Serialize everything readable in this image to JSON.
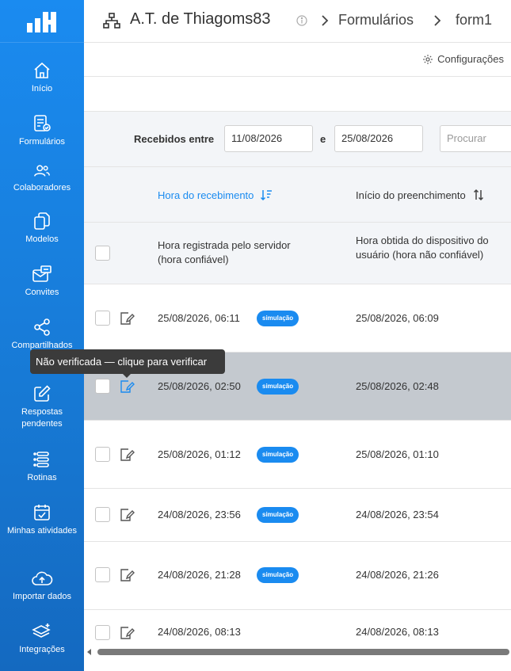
{
  "colors": {
    "accent": "#1a8bf0",
    "sidebar": "#1779d4",
    "highlight_row": "#c4c9cf",
    "tooltip_bg": "#3b3b3b"
  },
  "sidebar": {
    "logo_icon": "bar-chart-logo-icon",
    "items": [
      {
        "label": "Início",
        "icon": "home-icon"
      },
      {
        "label": "Formulários",
        "icon": "form-check-icon"
      },
      {
        "label": "Colaboradores",
        "icon": "users-icon"
      },
      {
        "label": "Modelos",
        "icon": "copy-icon"
      },
      {
        "label": "Convites",
        "icon": "invite-mail-icon"
      },
      {
        "label": "Compartilhados",
        "icon": "share-icon"
      },
      {
        "label": "Respostas pendentes",
        "icon": "edit-icon"
      },
      {
        "label": "Rotinas",
        "icon": "list-icon"
      },
      {
        "label": "Minhas atividades",
        "icon": "calendar-check-icon"
      },
      {
        "label": "Importar dados",
        "icon": "cloud-upload-icon"
      },
      {
        "label": "Integrações",
        "icon": "layers-icon"
      }
    ]
  },
  "header": {
    "org_title": "A.T. de Thiagoms83",
    "crumb_forms": "Formulários",
    "crumb_form": "form1",
    "config_label": "Configurações"
  },
  "filters": {
    "received_between": "Recebidos entre",
    "date_from": "11/08/2026",
    "and": "e",
    "date_to": "25/08/2026",
    "search_placeholder": "Procurar"
  },
  "table": {
    "columns": [
      {
        "label": "Hora do recebimento",
        "description": "Hora registrada pelo servidor (hora confiável)",
        "sort": "sorted-desc"
      },
      {
        "label": "Início do preenchimento",
        "description": "Hora obtida do dispositivo do usuário (hora não confiável)",
        "sort": "sortable"
      }
    ],
    "rows": [
      {
        "received": "25/08/2026, 06:11",
        "badge": "simulação",
        "started": "25/08/2026, 06:09"
      },
      {
        "received": "25/08/2026, 02:50",
        "badge": "simulação",
        "started": "25/08/2026, 02:48"
      },
      {
        "received": "25/08/2026, 01:12",
        "badge": "simulação",
        "started": "25/08/2026, 01:10"
      },
      {
        "received": "24/08/2026, 23:56",
        "badge": "simulação",
        "started": "24/08/2026, 23:54"
      },
      {
        "received": "24/08/2026, 21:28",
        "badge": "simulação",
        "started": "24/08/2026, 21:26"
      },
      {
        "received": "24/08/2026, 08:13",
        "badge": "",
        "started": "24/08/2026, 08:13"
      }
    ]
  },
  "tooltip": {
    "text": "Não verificada — clique para verificar"
  }
}
